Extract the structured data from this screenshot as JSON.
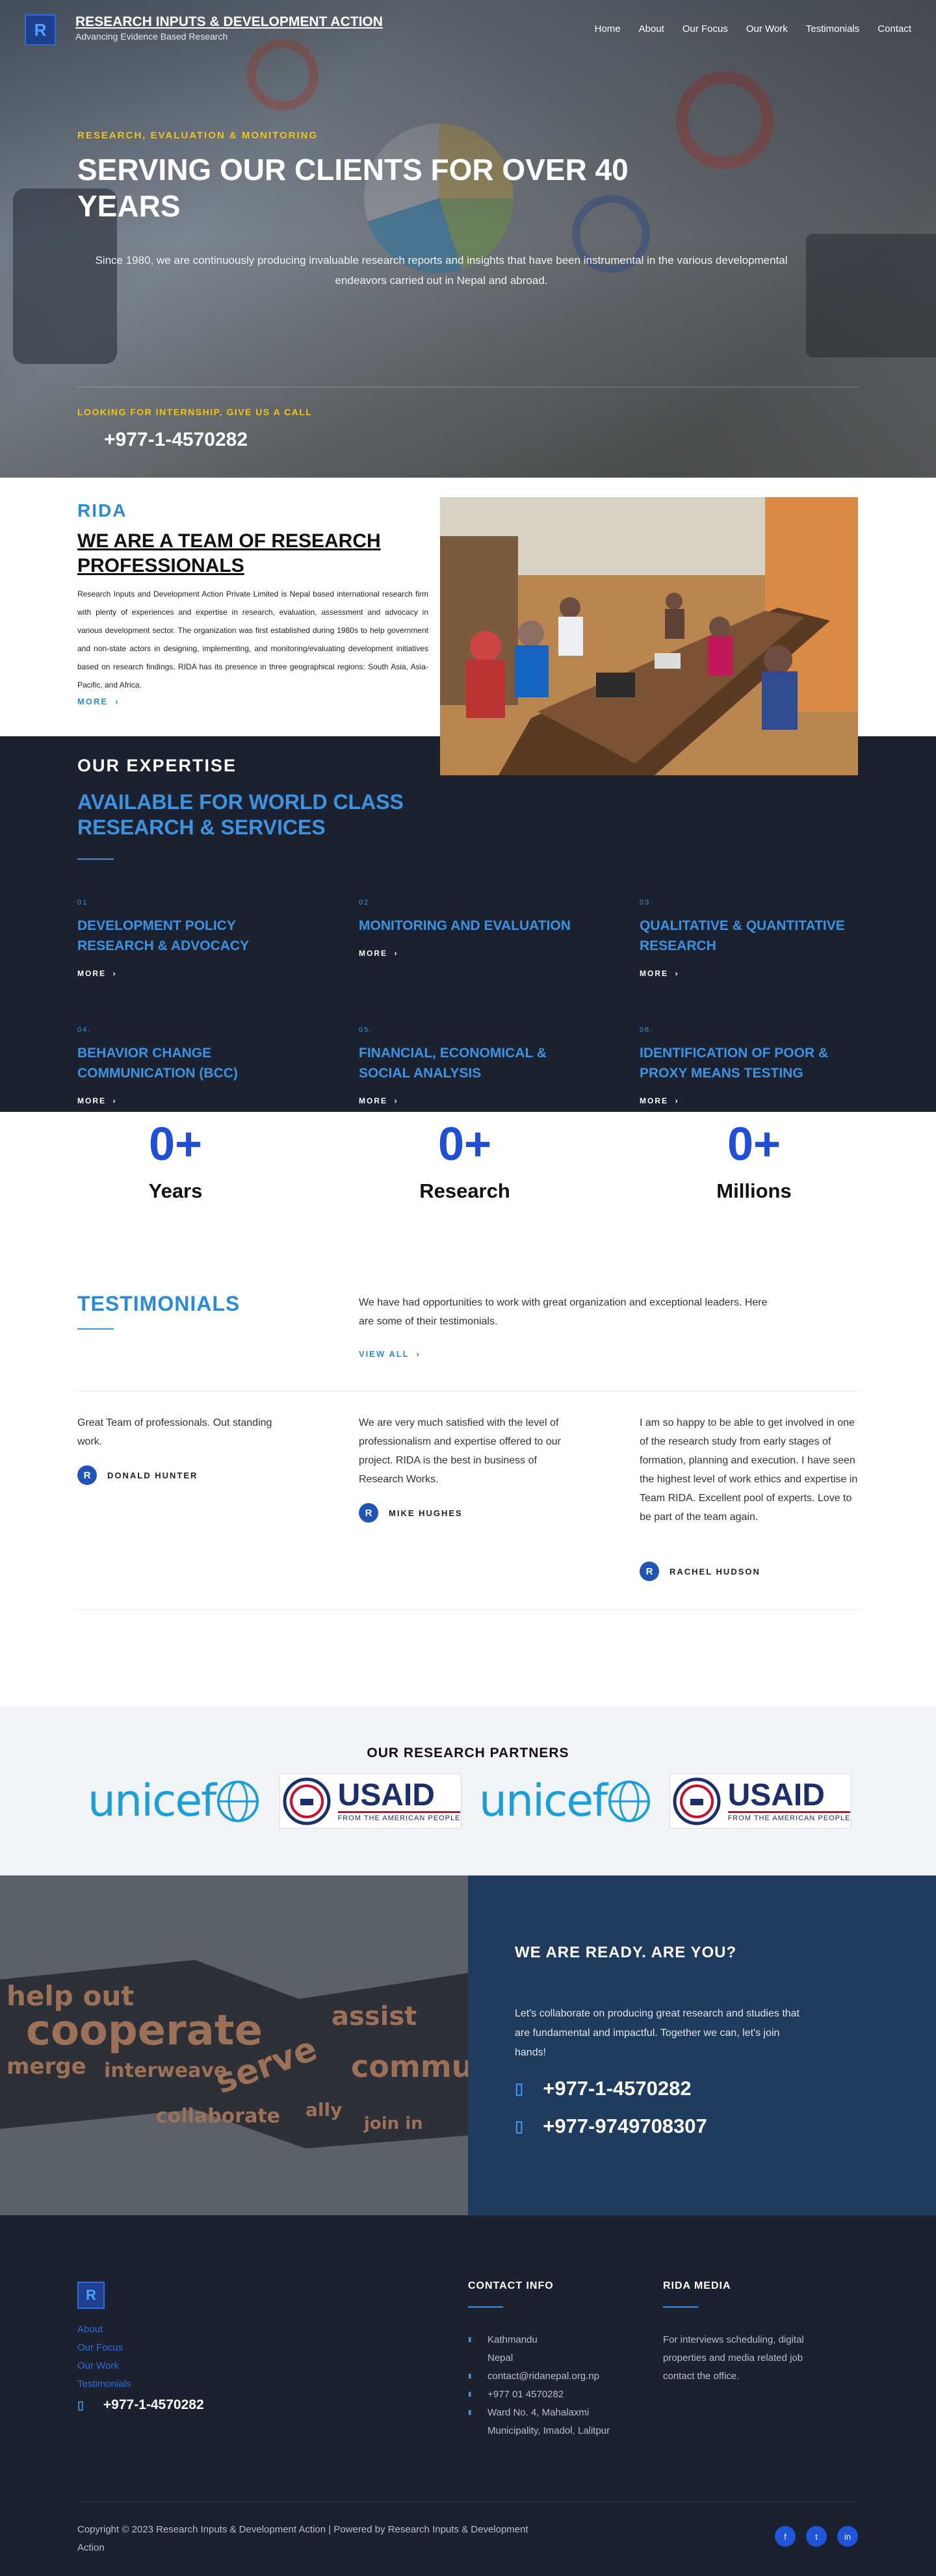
{
  "header": {
    "logo_letter": "R",
    "brand_title": "RESEARCH INPUTS & DEVELOPMENT ACTION",
    "brand_tagline": "Advancing Evidence Based Research",
    "menu": [
      "Home",
      "About",
      "Our Focus",
      "Our Work",
      "Testimonials",
      "Contact"
    ]
  },
  "hero": {
    "kicker": "RESEARCH, EVALUATION & MONITORING",
    "title": "SERVING OUR CLIENTS FOR OVER 40 YEARS",
    "lead": "Since 1980, we are continuously producing invaluable research reports and insights that have been instrumental in the various developmental endeavors carried out in Nepal and abroad.",
    "internship": "LOOKING FOR INTERNSHIP, GIVE US A CALL",
    "phone": "+977-1-4570282"
  },
  "about": {
    "tag": "RIDA",
    "title": "WE ARE A TEAM OF RESEARCH PROFESSIONALS",
    "body": "Research Inputs and Development Action Private Limited is Nepal based international research firm with plenty of experiences and expertise in research, evaluation, assessment and advocacy in various development sector. The organization was first established during 1980s to help government and non-state actors in designing, implementing, and monitoring/evaluating development initiatives based on research findings. RIDA has its presence in three geographical regions: South Asia, Asia-Pacific, and Africa.",
    "more": "MORE"
  },
  "expertise": {
    "heading": "OUR EXPERTISE",
    "subheading": "AVAILABLE FOR WORLD CLASS RESEARCH & SERVICES",
    "more": "MORE",
    "cards": [
      {
        "num": "01.",
        "title": "DEVELOPMENT POLICY RESEARCH & ADVOCACY"
      },
      {
        "num": "02.",
        "title": "MONITORING AND EVALUATION"
      },
      {
        "num": "03.",
        "title": "QUALITATIVE & QUANTITATIVE RESEARCH"
      },
      {
        "num": "04.",
        "title": "BEHAVIOR CHANGE COMMUNICATION (BCC)"
      },
      {
        "num": "05.",
        "title": "FINANCIAL, ECONOMICAL & SOCIAL ANALYSIS"
      },
      {
        "num": "06.",
        "title": "IDENTIFICATION OF POOR & PROXY MEANS TESTING"
      }
    ]
  },
  "stats": [
    {
      "value": "0+",
      "label": "Years"
    },
    {
      "value": "0+",
      "label": "Research"
    },
    {
      "value": "0+",
      "label": "Millions"
    }
  ],
  "testimonials": {
    "heading": "TESTIMONIALS",
    "intro": "We have had opportunities to work with great organization and exceptional leaders. Here are some of their testimonials.",
    "view_all": "VIEW ALL",
    "items": [
      {
        "quote": "Great Team of professionals. Out standing work.",
        "name": "DONALD HUNTER",
        "initial": "R"
      },
      {
        "quote": "We are very much satisfied with the level of professionalism and expertise offered to our project. RIDA is the best in business of Research Works.",
        "name": "MIKE HUGHES",
        "initial": "R"
      },
      {
        "quote": "I am so happy to be able to get involved in one of the research study from early stages of formation, planning and execution. I have seen the highest level of work ethics and expertise in Team RIDA. Excellent pool of experts. Love to be part of the team again.",
        "name": "RACHEL HUDSON",
        "initial": "R"
      }
    ]
  },
  "partners": {
    "heading": "OUR RESEARCH PARTNERS",
    "unicef": "unicef",
    "usaid": "USAID",
    "usaid_sub": "FROM THE AMERICAN PEOPLE"
  },
  "cta": {
    "heading": "WE ARE READY. ARE YOU?",
    "body": "Let's collaborate on producing great research and studies that are fundamental and impactful. Together we can, let's join hands!",
    "phone1": "+977-1-4570282",
    "phone2": "+977-9749708307",
    "words": [
      "help out",
      "cooperate",
      "merge",
      "interweave",
      "assist",
      "commu",
      "serve",
      "collaborate",
      "ally",
      "join in"
    ]
  },
  "footer": {
    "logo_letter": "R",
    "links": [
      "About",
      "Our Focus",
      "Our Work",
      "Testimonials"
    ],
    "phone": "+977-1-4570282",
    "contact_heading": "CONTACT INFO",
    "contact": [
      "Kathmandu",
      "Nepal",
      "contact@ridanepal.org.np",
      "+977 01 4570282",
      "Ward No. 4, Mahalaxmi Municipality, Imadol, Lalitpur"
    ],
    "media_heading": "RIDA MEDIA",
    "media_text": "For interviews scheduling, digital properties and media related job contact the office.",
    "copyright": "Copyright © 2023 Research Inputs & Development Action | Powered by Research Inputs & Development Action"
  },
  "colors": {
    "accent": "#2a8bdc",
    "dark": "#1b212e",
    "gold": "#f0c419",
    "stat_blue": "#1f4fd8",
    "cta_blue": "#1f3b5e"
  }
}
